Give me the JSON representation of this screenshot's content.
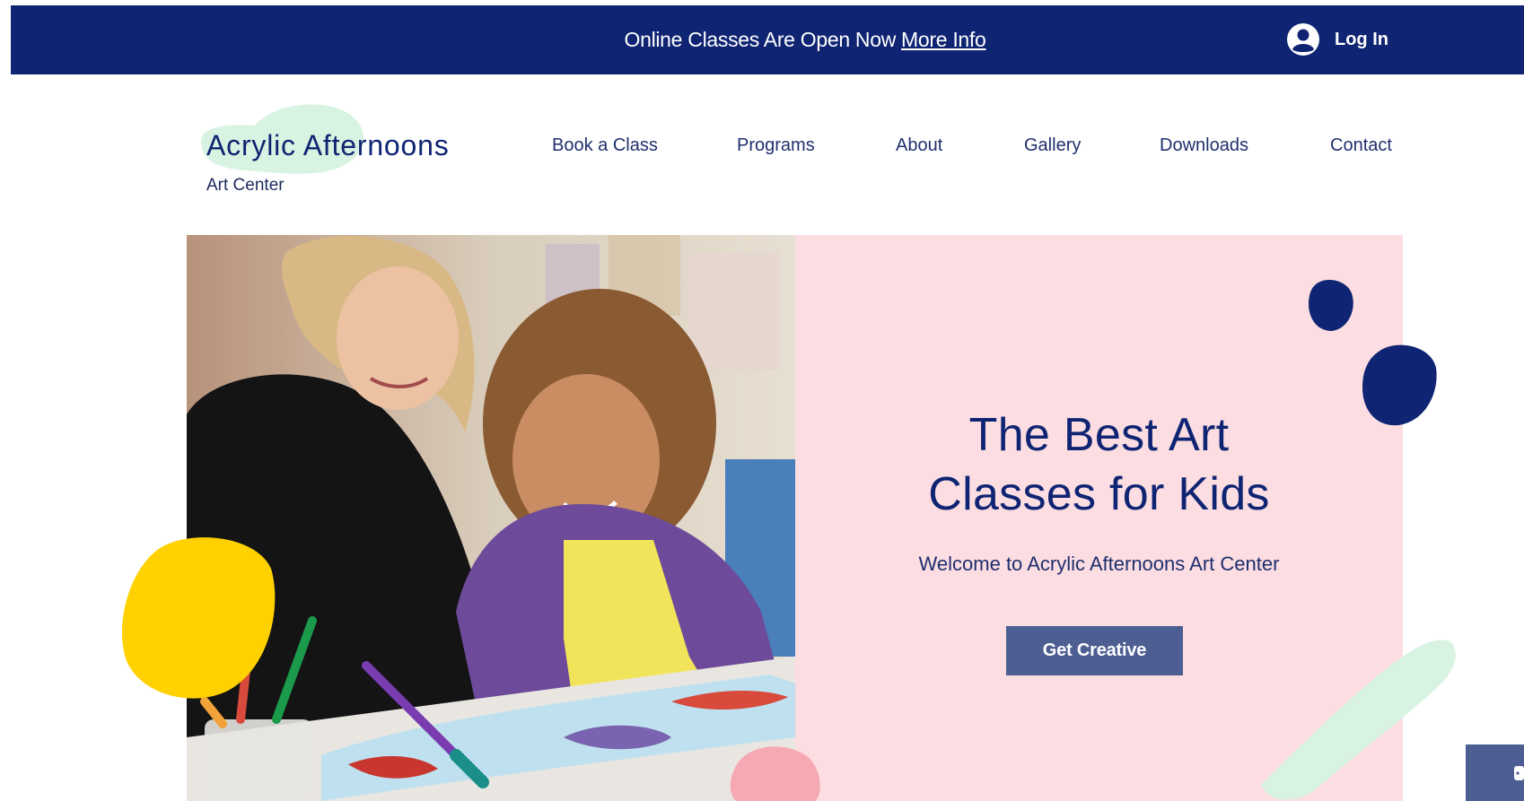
{
  "topbar": {
    "announcement": "Online Classes Are Open Now",
    "more_info": "More Info",
    "login_label": "Log In",
    "login_icon": "user-avatar-icon"
  },
  "brand": {
    "name": "Acrylic Afternoons",
    "subtitle": "Art Center"
  },
  "nav": {
    "items": [
      "Book a Class",
      "Programs",
      "About",
      "Gallery",
      "Downloads",
      "Contact"
    ]
  },
  "hero": {
    "title_line1": "The Best Art",
    "title_line2": "Classes for Kids",
    "subtitle": "Welcome to Acrylic Afternoons Art Center",
    "cta_label": "Get Creative"
  },
  "colors": {
    "navy": "#0f2472",
    "pink": "#fbdde2",
    "button": "#4d5e93",
    "mint": "#d8f3e2",
    "yellow": "#ffd100"
  }
}
